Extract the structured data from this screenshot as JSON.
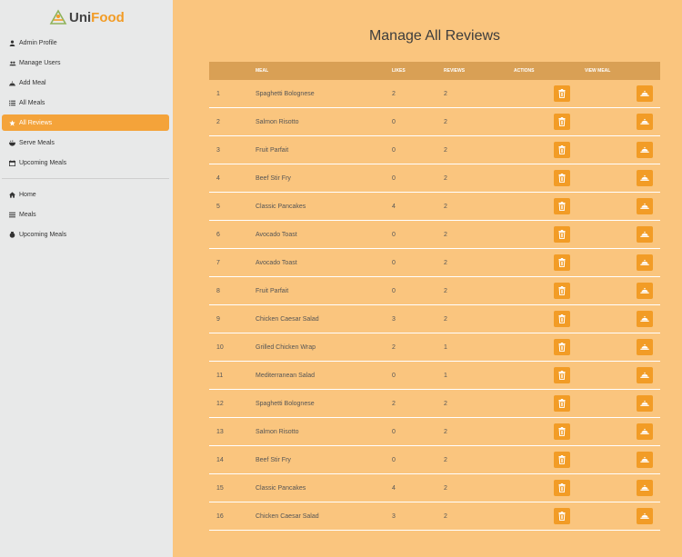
{
  "brand": {
    "uni": "Uni",
    "food": "Food"
  },
  "sidebar": {
    "items": [
      {
        "label": "Admin Profile",
        "icon": "user-icon"
      },
      {
        "label": "Manage Users",
        "icon": "users-icon"
      },
      {
        "label": "Add Meal",
        "icon": "add-meal-icon"
      },
      {
        "label": "All Meals",
        "icon": "list-icon"
      },
      {
        "label": "All Reviews",
        "icon": "star-icon",
        "active": true
      },
      {
        "label": "Serve Meals",
        "icon": "serve-icon"
      },
      {
        "label": "Upcoming Meals",
        "icon": "calendar-icon"
      }
    ],
    "bottom_items": [
      {
        "label": "Home",
        "icon": "home-icon"
      },
      {
        "label": "Meals",
        "icon": "menu-icon"
      },
      {
        "label": "Upcoming Meals",
        "icon": "upcoming-icon"
      }
    ]
  },
  "page": {
    "title": "Manage All Reviews"
  },
  "table": {
    "headers": {
      "num": "",
      "meal": "Meal",
      "likes": "Likes",
      "reviews": "Reviews",
      "actions": "Actions",
      "view": "View Meal"
    },
    "rows": [
      {
        "num": "1",
        "meal": "Spaghetti Bolognese",
        "likes": "2",
        "reviews": "2"
      },
      {
        "num": "2",
        "meal": "Salmon Risotto",
        "likes": "0",
        "reviews": "2"
      },
      {
        "num": "3",
        "meal": "Fruit Parfait",
        "likes": "0",
        "reviews": "2"
      },
      {
        "num": "4",
        "meal": "Beef Stir Fry",
        "likes": "0",
        "reviews": "2"
      },
      {
        "num": "5",
        "meal": "Classic Pancakes",
        "likes": "4",
        "reviews": "2"
      },
      {
        "num": "6",
        "meal": "Avocado Toast",
        "likes": "0",
        "reviews": "2"
      },
      {
        "num": "7",
        "meal": "Avocado Toast",
        "likes": "0",
        "reviews": "2"
      },
      {
        "num": "8",
        "meal": "Fruit Parfait",
        "likes": "0",
        "reviews": "2"
      },
      {
        "num": "9",
        "meal": "Chicken Caesar Salad",
        "likes": "3",
        "reviews": "2"
      },
      {
        "num": "10",
        "meal": "Grilled Chicken Wrap",
        "likes": "2",
        "reviews": "1"
      },
      {
        "num": "11",
        "meal": "Mediterranean Salad",
        "likes": "0",
        "reviews": "1"
      },
      {
        "num": "12",
        "meal": "Spaghetti Bolognese",
        "likes": "2",
        "reviews": "2"
      },
      {
        "num": "13",
        "meal": "Salmon Risotto",
        "likes": "0",
        "reviews": "2"
      },
      {
        "num": "14",
        "meal": "Beef Stir Fry",
        "likes": "0",
        "reviews": "2"
      },
      {
        "num": "15",
        "meal": "Classic Pancakes",
        "likes": "4",
        "reviews": "2"
      },
      {
        "num": "16",
        "meal": "Chicken Caesar Salad",
        "likes": "3",
        "reviews": "2"
      }
    ]
  },
  "icons": {
    "delete": "trash-icon",
    "view": "dish-icon"
  },
  "colors": {
    "accent": "#f29c26",
    "background": "#fac57e",
    "sidebar": "#e8e9e9",
    "header": "#d9a055"
  }
}
